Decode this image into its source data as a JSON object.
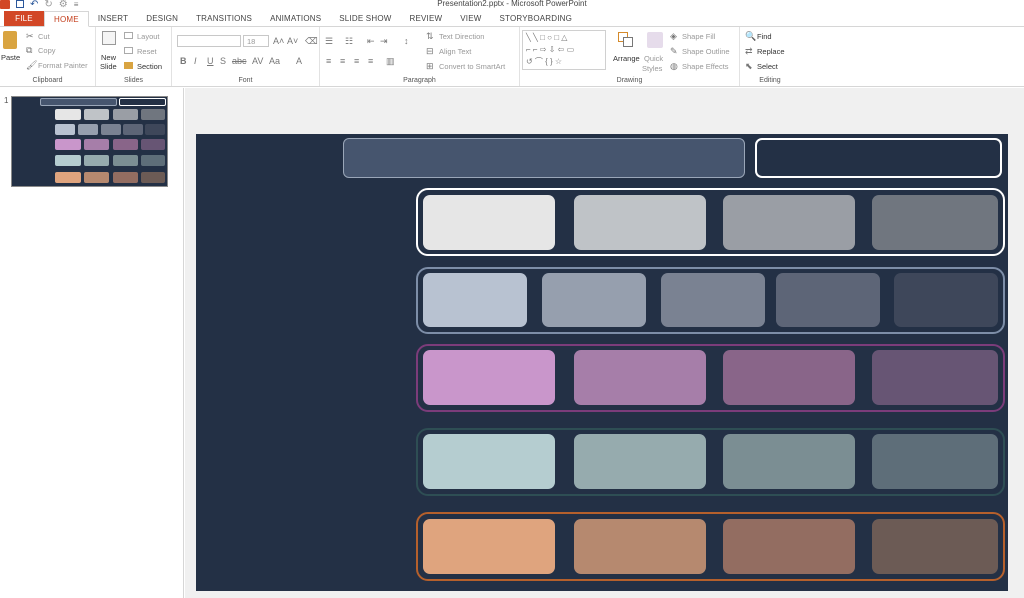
{
  "window": {
    "title": "Presentation2.pptx - Microsoft PowerPoint"
  },
  "tabs": [
    "FILE",
    "HOME",
    "INSERT",
    "DESIGN",
    "TRANSITIONS",
    "ANIMATIONS",
    "SLIDE SHOW",
    "REVIEW",
    "VIEW",
    "STORYBOARDING"
  ],
  "ribbon": {
    "clipboard": {
      "paste": "Paste",
      "cut": "Cut",
      "copy": "Copy",
      "format_painter": "Format Painter",
      "label": "Clipboard"
    },
    "slides": {
      "new_slide_1": "New",
      "new_slide_2": "Slide",
      "layout": "Layout",
      "reset": "Reset",
      "section": "Section",
      "label": "Slides"
    },
    "font": {
      "size": "18",
      "label": "Font"
    },
    "paragraph": {
      "text_direction": "Text Direction",
      "align_text": "Align Text",
      "convert": "Convert to SmartArt",
      "label": "Paragraph"
    },
    "drawing": {
      "arrange": "Arrange",
      "quick_1": "Quick",
      "quick_2": "Styles",
      "shape_fill": "Shape Fill",
      "shape_outline": "Shape Outline",
      "shape_effects": "Shape Effects",
      "label": "Drawing"
    },
    "editing": {
      "find": "Find",
      "replace": "Replace",
      "select": "Select",
      "label": "Editing"
    }
  },
  "thumbnail": {
    "number": "1"
  },
  "colors": {
    "slide_bg": "#233045",
    "row1": [
      "#e6e6e6",
      "#bfc3c7",
      "#9a9ea5",
      "#70767f"
    ],
    "row2": [
      "#b8c2d1",
      "#969fae",
      "#7a8292",
      "#5d6577",
      "#3e475a"
    ],
    "row3": [
      "#c996cb",
      "#a67ea9",
      "#896589",
      "#675574"
    ],
    "row4": [
      "#b5cdd0",
      "#96abae",
      "#7b8e93",
      "#5e6e79"
    ],
    "row5": [
      "#dfa47e",
      "#b6896f",
      "#936d61",
      "#6c5b55"
    ]
  }
}
